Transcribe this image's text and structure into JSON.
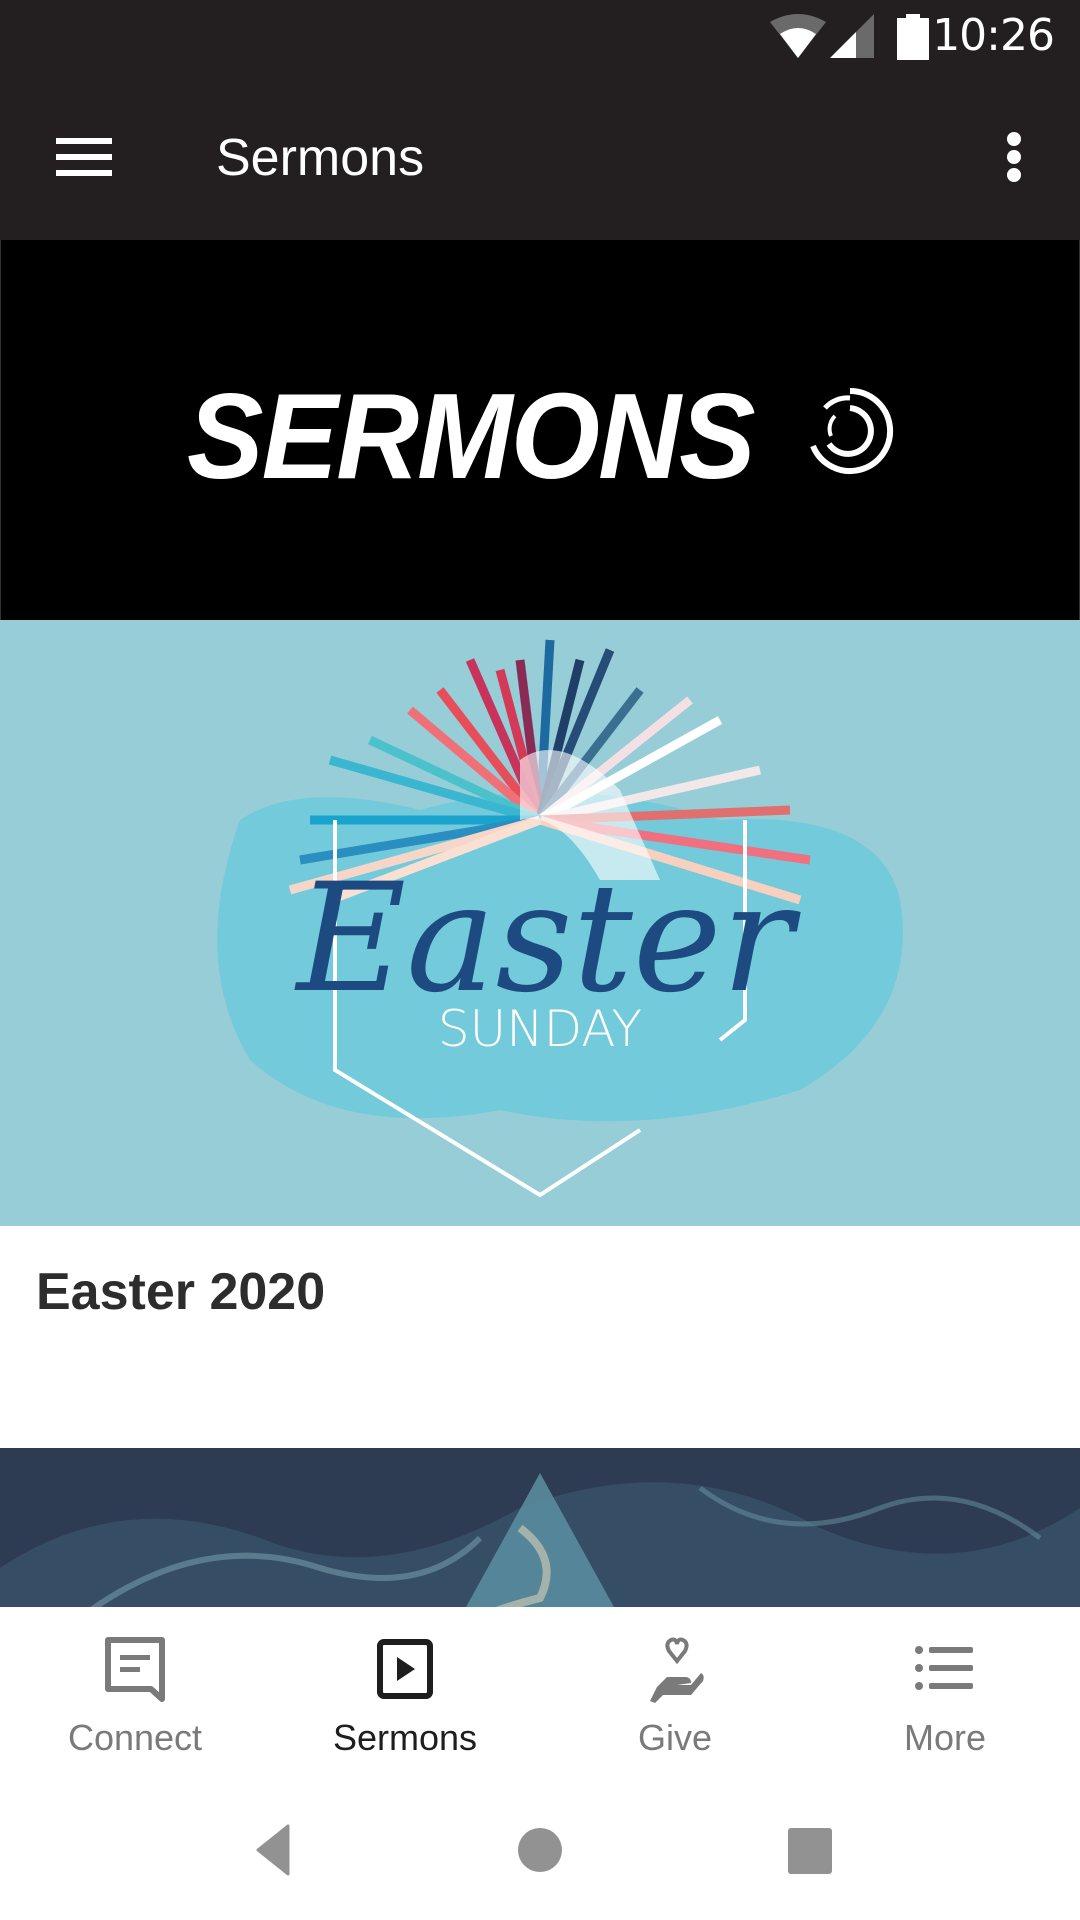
{
  "status_bar": {
    "time": "10:26",
    "icons": [
      "wifi-icon",
      "cell-signal-icon",
      "battery-icon"
    ]
  },
  "toolbar": {
    "title": "Sermons",
    "menu_icon": "hamburger-menu-icon",
    "overflow_icon": "more-vert-icon"
  },
  "banner": {
    "text": "SERMONS"
  },
  "sermons": [
    {
      "image_text_script": "Easter",
      "image_text_caption": "SUNDAY",
      "title": "Easter 2020",
      "colors": {
        "background": "#96cdd6",
        "script": "#1d4a80"
      }
    }
  ],
  "bottom_nav": {
    "items": [
      {
        "label": "Connect",
        "icon": "chat-message-icon",
        "active": false
      },
      {
        "label": "Sermons",
        "icon": "play-video-icon",
        "active": true
      },
      {
        "label": "Give",
        "icon": "hand-heart-icon",
        "active": false
      },
      {
        "label": "More",
        "icon": "list-icon",
        "active": false
      }
    ]
  },
  "system_nav": {
    "buttons": [
      "back",
      "home",
      "recents"
    ]
  },
  "colors": {
    "app_bar": "#231f20",
    "nav_inactive": "#7a7a7a",
    "nav_active": "#1e1e1e"
  }
}
